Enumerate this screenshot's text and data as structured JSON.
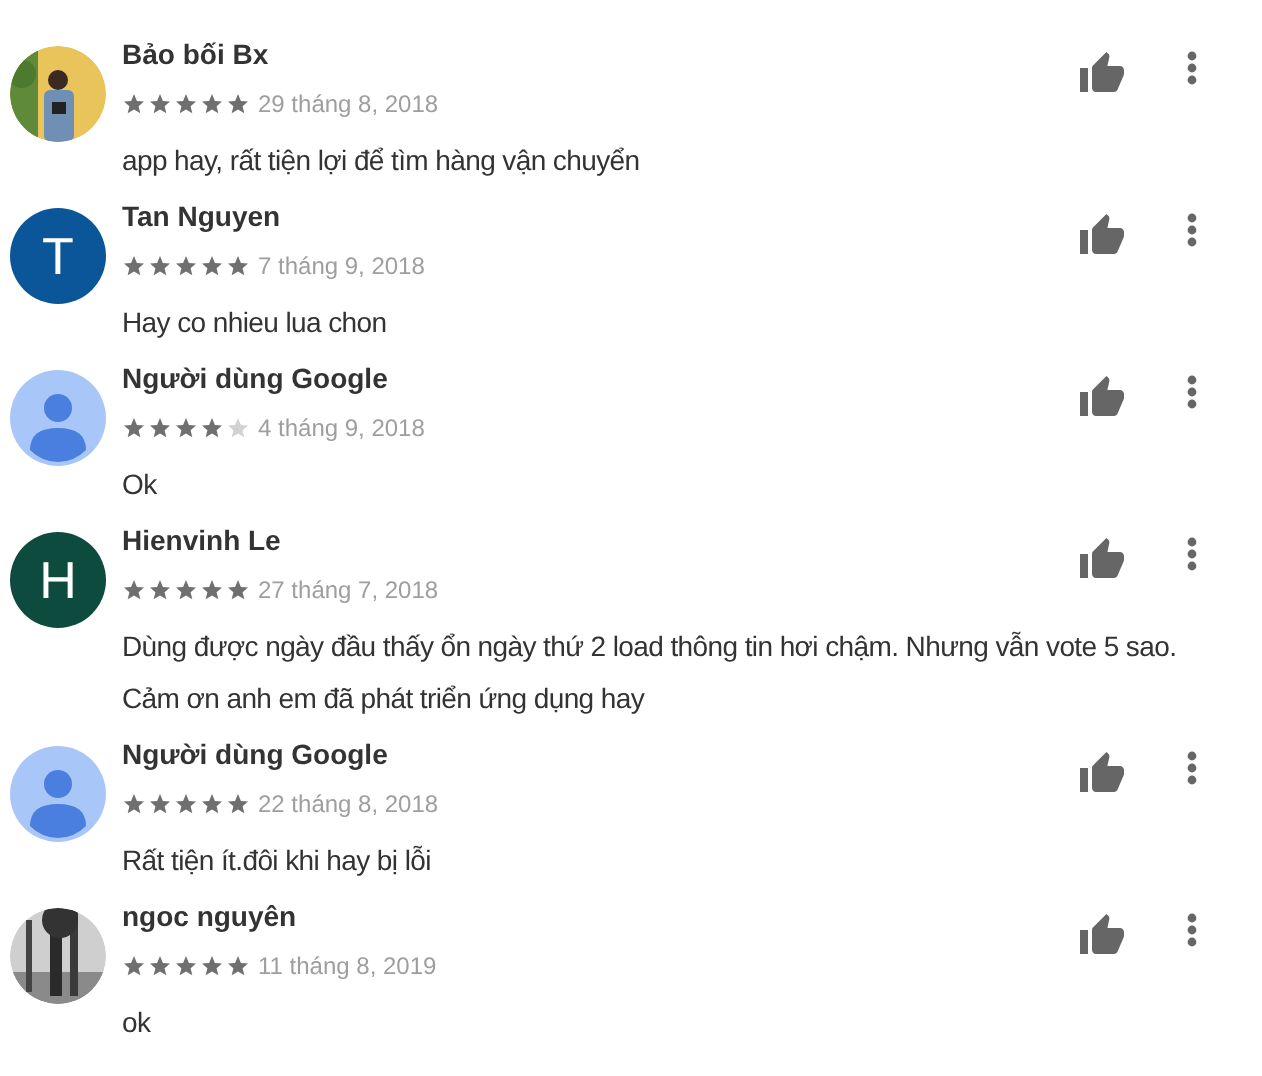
{
  "reviews": [
    {
      "author": "Bảo bối Bx",
      "stars": 5,
      "date": "29 tháng 8, 2018",
      "text": "app hay, rất tiện lợi để tìm hàng vận chuyển"
    },
    {
      "author": "Tan Nguyen",
      "avatar": {
        "kind": "letter",
        "letter": "T",
        "color": "#0b5599"
      },
      "stars": 5,
      "date": "7 tháng 9, 2018",
      "text": "Hay co nhieu lua chon"
    },
    {
      "author": "Người dùng Google",
      "avatar": {
        "kind": "default"
      },
      "stars": 4,
      "date": "4 tháng 9, 2018",
      "text": "Ok"
    },
    {
      "author": "Hienvinh Le",
      "avatar": {
        "kind": "letter",
        "letter": "H",
        "color": "#0c4b3e"
      },
      "stars": 5,
      "date": "27 tháng 7, 2018",
      "text": "Dùng được ngày đầu thấy ổn ngày thứ 2 load thông tin hơi chậm. Nhưng vẫn vote 5 sao. Cảm ơn anh em đã phát triển ứng dụng hay"
    },
    {
      "author": "Người dùng Google",
      "avatar": {
        "kind": "default"
      },
      "stars": 5,
      "date": "22 tháng 8, 2018",
      "text": "Rất tiện ít.đôi khi hay bị lỗi"
    },
    {
      "author": "ngoc nguyên",
      "stars": 5,
      "date": "11 tháng 8, 2019",
      "text": "ok"
    }
  ]
}
